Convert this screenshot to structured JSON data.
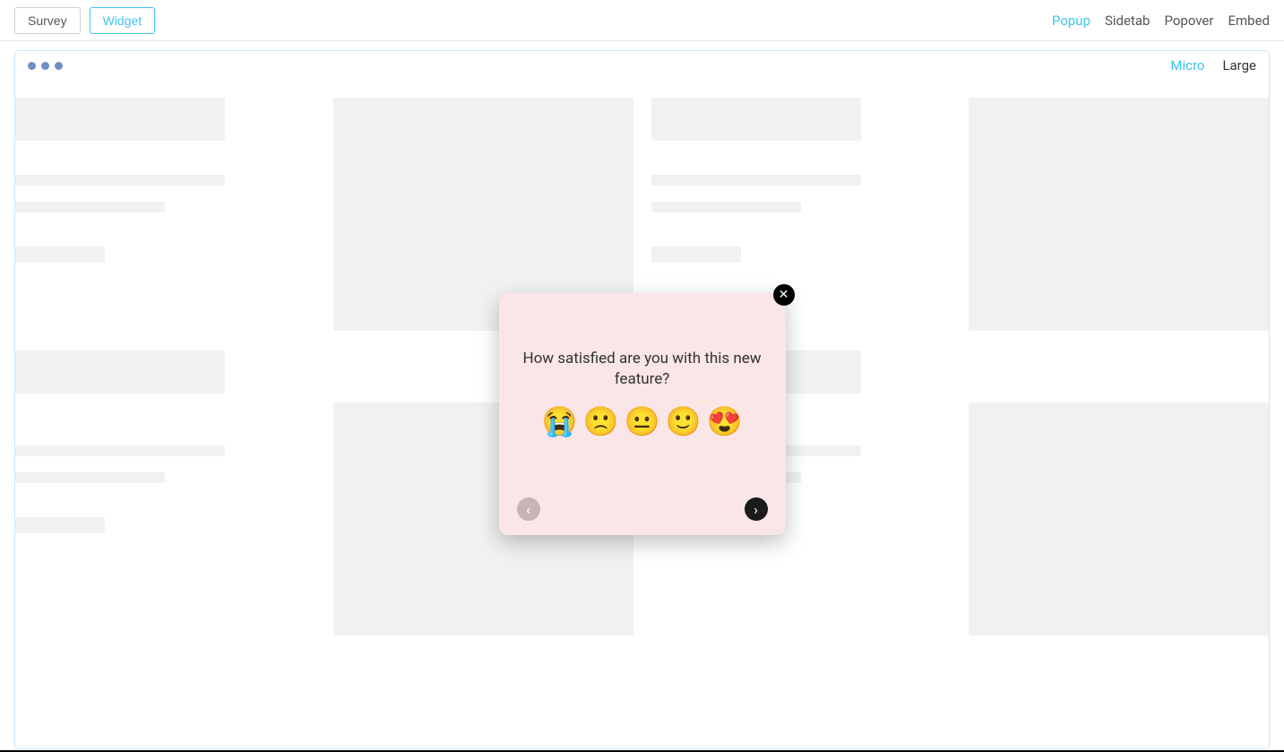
{
  "header": {
    "leftTabs": {
      "survey": "Survey",
      "widget": "Widget"
    },
    "rightTabs": {
      "popup": "Popup",
      "sidetab": "Sidetab",
      "popover": "Popover",
      "embed": "Embed"
    }
  },
  "frame": {
    "sizeTabs": {
      "micro": "Micro",
      "large": "Large"
    }
  },
  "popup": {
    "question": "How satisfied are you with this new feature?",
    "emojis": {
      "crying": "😭",
      "frown": "🙁",
      "neutral": "😐",
      "smile": "🙂",
      "heart_eyes": "😍"
    },
    "closeGlyph": "✕",
    "prevGlyph": "‹",
    "nextGlyph": "›"
  }
}
